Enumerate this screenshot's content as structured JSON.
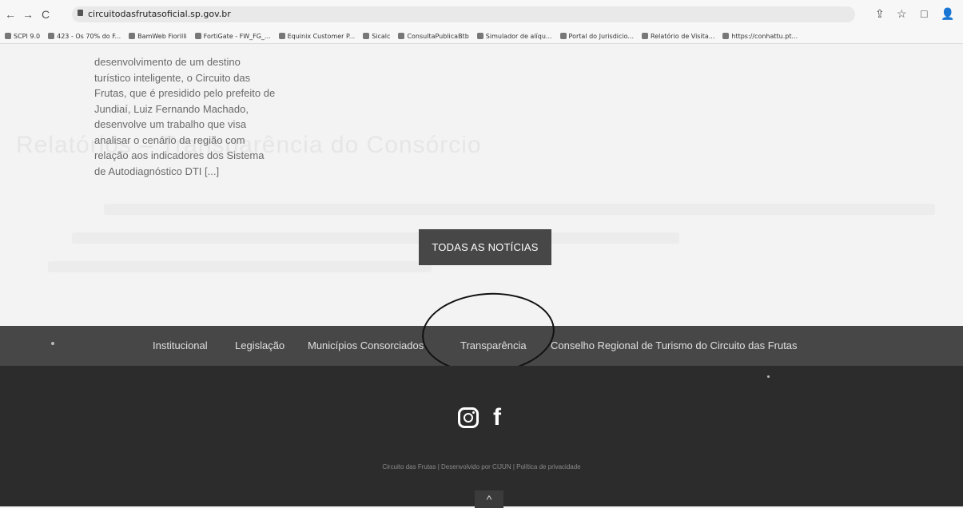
{
  "browser": {
    "url": "circuitodasfrutasoficial.sp.gov.br",
    "bookmarks": [
      "SCPI 9.0",
      "423 - Os 70% do F...",
      "BamWeb Fiorilli",
      "FortiGate - FW_FG_...",
      "Equinix Customer P...",
      "Sicalc",
      "ConsultaPublicaBtb",
      "Simulador de alíqu...",
      "Portal do Jurisdicio...",
      "Relatório de Visita...",
      "https://conhattu.pt..."
    ],
    "icons": {
      "back": "←",
      "forward": "→",
      "reload": "C",
      "share": "⇪",
      "star": "☆",
      "window": "□",
      "profile": "👤"
    }
  },
  "article": {
    "text": "desenvolvimento de um destino turístico inteligente, o Circuito das Frutas, que é presidido pelo prefeito de Jundiaí, Luiz Fernando Machado, desenvolve um trabalho que visa analisar o cenário da região com relação aos indicadores dos Sistema de Autodiagnóstico DTI [...]"
  },
  "ghost": {
    "title": "Relatórios – Transparência do Consórcio"
  },
  "buttons": {
    "all_news": "TODAS AS NOTÍCIAS"
  },
  "footer": {
    "nav": [
      "Institucional",
      "Legislação",
      "Municípios Consorciados",
      "Transparência",
      "Conselho Regional de Turismo do Circuito das Frutas"
    ],
    "social": {
      "facebook_glyph": "f"
    },
    "copyright": "Circuito das Frutas | Desenvolvido por CIJUN | Política de privacidade",
    "back_to_top": "^"
  }
}
